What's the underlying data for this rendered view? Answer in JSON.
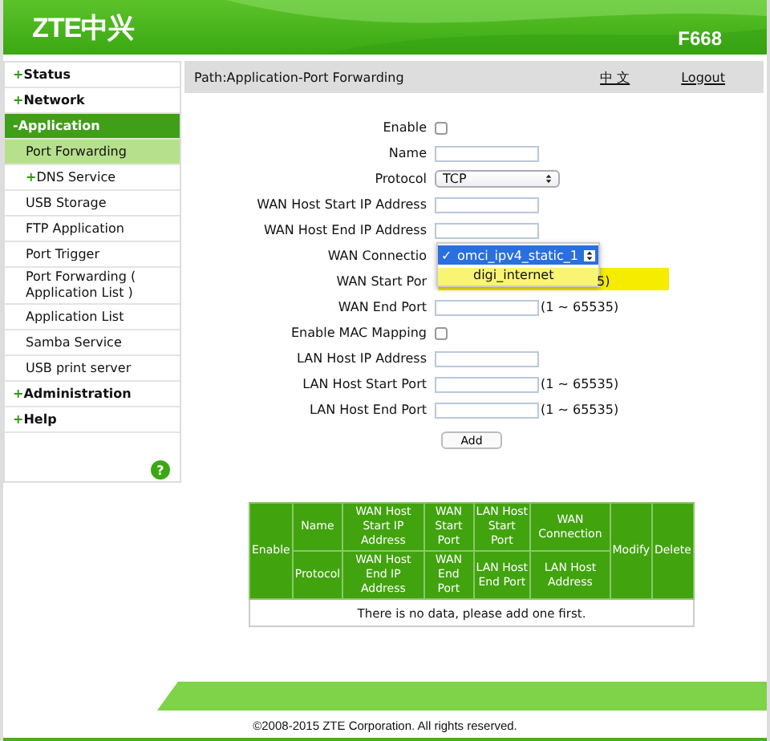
{
  "header": {
    "logo": "ZTE中兴",
    "model": "F668"
  },
  "sidebar": {
    "items": [
      {
        "label": "Status",
        "marker": "+",
        "kind": "section",
        "selected": false
      },
      {
        "label": "Network",
        "marker": "+",
        "kind": "section",
        "selected": false
      },
      {
        "label": "Application",
        "marker": "-",
        "kind": "section",
        "selected": true
      },
      {
        "label": "Port Forwarding",
        "kind": "sub",
        "selected": true
      },
      {
        "label": "DNS Service",
        "marker": "+",
        "kind": "sub",
        "selected": false
      },
      {
        "label": "USB Storage",
        "kind": "sub",
        "selected": false
      },
      {
        "label": "FTP Application",
        "kind": "sub",
        "selected": false
      },
      {
        "label": "Port Trigger",
        "kind": "sub",
        "selected": false
      },
      {
        "label": "Port Forwarding ( Application List )",
        "kind": "sub",
        "selected": false
      },
      {
        "label": "Application List",
        "kind": "sub",
        "selected": false
      },
      {
        "label": "Samba Service",
        "kind": "sub",
        "selected": false
      },
      {
        "label": "USB print server",
        "kind": "sub",
        "selected": false
      },
      {
        "label": "Administration",
        "marker": "+",
        "kind": "section",
        "selected": false
      },
      {
        "label": "Help",
        "marker": "+",
        "kind": "section",
        "selected": false
      }
    ],
    "help_icon": "?"
  },
  "path_bar": {
    "path": "Path:Application-Port Forwarding",
    "language": "中 文",
    "logout": "Logout"
  },
  "form": {
    "fields": [
      {
        "kind": "checkbox",
        "label": "Enable",
        "checked": false
      },
      {
        "kind": "text",
        "label": "Name"
      },
      {
        "kind": "select",
        "label": "Protocol",
        "value": "TCP"
      },
      {
        "kind": "text",
        "label": "WAN Host Start IP Address"
      },
      {
        "kind": "text",
        "label": "WAN Host End IP Address"
      },
      {
        "kind": "dropdown-open",
        "label": "WAN Connectio",
        "options": [
          {
            "label": "omci_ipv4_static_1",
            "marker": "✓",
            "selected": true
          },
          {
            "label": "digi_internet",
            "selected": false
          }
        ]
      },
      {
        "kind": "covered",
        "label": "WAN Start Por",
        "range": "5)"
      },
      {
        "kind": "text",
        "label": "WAN End Port",
        "range": "(1 ~ 65535)"
      },
      {
        "kind": "checkbox",
        "label": "Enable MAC Mapping",
        "checked": false
      },
      {
        "kind": "text",
        "label": "LAN Host IP Address"
      },
      {
        "kind": "text",
        "label": "LAN Host Start Port",
        "range": "(1 ~ 65535)"
      },
      {
        "kind": "text",
        "label": "LAN Host End Port",
        "range": "(1 ~ 65535)"
      }
    ],
    "add_button": "Add"
  },
  "table": {
    "columns": [
      {
        "label": "Enable"
      },
      {
        "label": "Name",
        "sub": "Protocol"
      },
      {
        "label": "WAN Host Start IP Address",
        "sub": "WAN Host End IP Address"
      },
      {
        "label": "WAN Start Port",
        "sub": "WAN End Port"
      },
      {
        "label": "LAN Host Start Port",
        "sub": "LAN Host End Port"
      },
      {
        "label": "WAN Connection",
        "sub": "LAN Host Address"
      },
      {
        "label": "Modify"
      },
      {
        "label": "Delete"
      }
    ],
    "empty_message": "There is no data, please add one first."
  },
  "footer": {
    "copyright": "©2008-2015 ZTE Corporation. All rights reserved."
  }
}
